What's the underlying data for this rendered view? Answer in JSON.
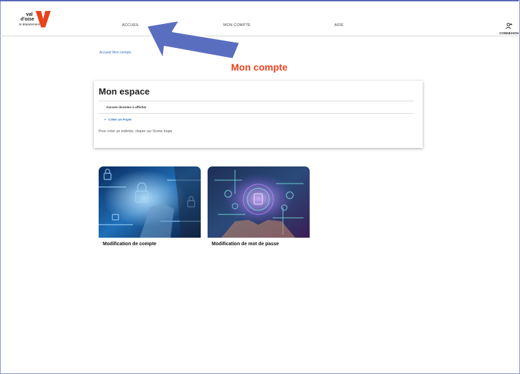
{
  "logo": {
    "line1": "val",
    "line2": "d'oise",
    "line3": "le département"
  },
  "nav": {
    "accueil": "ACCUEIL",
    "mon_compte": "MON COMPTE",
    "aide": "AIDE",
    "connexion": "CONNEXION"
  },
  "breadcrumb": "Accueil/ Mon compte",
  "page_title": "Mon compte",
  "card": {
    "title": "Mon espace",
    "empty_text": "Aucune données à afficher",
    "create_link": "Créer un Foyer",
    "hint": "Pour créer un individu, cliquer sur l'icone loupe"
  },
  "tiles": [
    {
      "caption": "Modification de compte"
    },
    {
      "caption": "Modification de mot de passe"
    }
  ],
  "colors": {
    "accent": "#e8421d",
    "link": "#2a6fc4",
    "annotation_arrow": "#5a6ec0"
  }
}
